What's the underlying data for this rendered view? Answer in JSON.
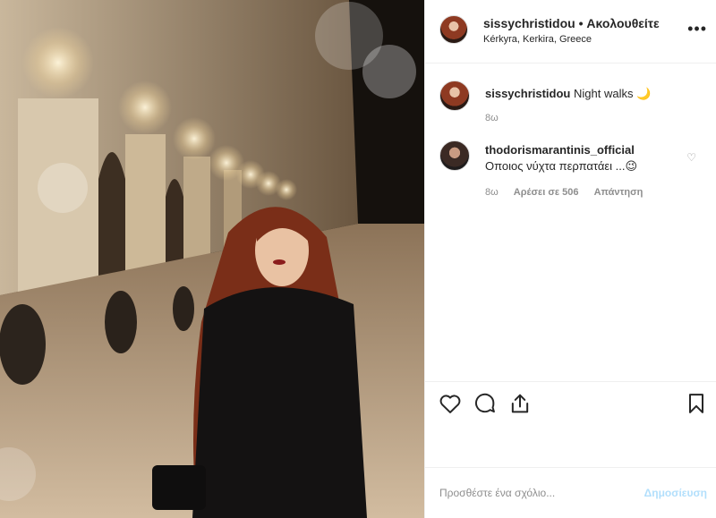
{
  "header": {
    "username": "sissychristidou",
    "separator": "•",
    "follow_status": "Ακολουθείτε",
    "location": "Kérkyra, Kerkira, Greece",
    "more_icon": "more-dots-icon"
  },
  "caption": {
    "username": "sissychristidou",
    "text": "Night walks 🌙",
    "time": "8ω"
  },
  "comments": [
    {
      "username": "thodorismarantinis_official",
      "text": "Οποιος νύχτα περπατάει ...😉",
      "time": "8ω",
      "likes": "Αρέσει σε 506",
      "reply": "Απάντηση"
    }
  ],
  "actions": {
    "like_icon": "heart-icon",
    "comment_icon": "comment-icon",
    "share_icon": "share-icon",
    "save_icon": "bookmark-icon"
  },
  "add_comment": {
    "placeholder": "Προσθέστε ένα σχόλιο...",
    "post_label": "Δημοσίευση"
  },
  "colors": {
    "post_button_disabled": "#b2dffc",
    "meta_text": "#8e8e8e",
    "border": "#efefef"
  }
}
